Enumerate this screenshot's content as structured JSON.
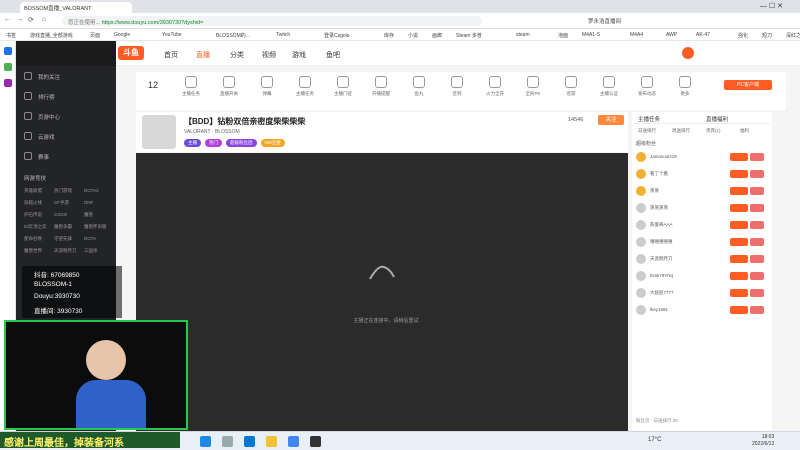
{
  "browser": {
    "tab_title": "BOSSOM直播_VALORANT",
    "url_prefix": "您正在使用...",
    "url": "https://www.douyu.com/3930730?dyshid=",
    "bookmarks": [
      "书签",
      "游戏直播_全部游戏",
      "页面",
      "Google",
      "YouTube",
      "BLOSSOM的...",
      "Twitch",
      "登录Csgola",
      "库存",
      "小说",
      "画廊",
      "Steam 多普",
      "steam",
      "泡面",
      "M4A1-S",
      "M4A4",
      "AWP",
      "AK-47",
      "强化",
      "短刀",
      "深红之"
    ],
    "addressbar_right_label": "罗永浩直播间"
  },
  "site": {
    "logo": "斗鱼",
    "nav": [
      "首页",
      "直播",
      "分类",
      "视频",
      "游戏",
      "鱼吧"
    ]
  },
  "sidebar": {
    "items": [
      "我的关注",
      "排行榜",
      "页游中心",
      "云游戏",
      "赛事"
    ],
    "section_title": "网游竞技",
    "games": [
      [
        "英雄联盟",
        "热门游戏",
        "DOTA2"
      ],
      [
        "穿越火线",
        "CF手游",
        "DNF"
      ],
      [
        "炉石传说",
        "CSGO",
        "魔兽"
      ],
      [
        "lol云顶之弈",
        "魔兽争霸",
        "魔兽怀旧服"
      ],
      [
        "使命召唤",
        "守望先锋",
        "DOTA"
      ],
      [
        "魔兽世界",
        "天涯明月刀",
        "三国杀"
      ]
    ]
  },
  "toolbar": {
    "count": "12",
    "items": [
      "主播任务",
      "直播开关",
      "弹幕",
      "主播任务",
      "主播门徒",
      "开播提醒",
      "鱼丸",
      "签到",
      "火力全开",
      "全民PK",
      "巡游",
      "主播认证",
      "发布动态",
      "更多"
    ],
    "pc_button": "PC客户端"
  },
  "room": {
    "badge": "【BDD】",
    "title": "钻粉双倍亲密度柴柴柴柴",
    "category_tag": "VALORANT",
    "owner": "BLOSSOM",
    "online": "14546",
    "follow_label": "关注",
    "tags": [
      "主播",
      "热门",
      "超级粉丝团",
      "NW连胜"
    ]
  },
  "player": {
    "status_text": "主播正在连接中，请稍后重试"
  },
  "chat": {
    "tabs": [
      "主播任务",
      "直播福利"
    ],
    "sub_tabs": [
      "日送排行",
      "周送排行",
      "贵宾(1)",
      "福利"
    ],
    "hot_label": "超级粉丝",
    "rows": [
      "Jamosoul219",
      "看了个看",
      "蒸蒸",
      "蒸蒸蒸蒸",
      "陈俊奇AAA",
      "嘻嘻嘻嘻嘻",
      "天涯明月刀",
      "Erek79YNq",
      "大屁屁7777",
      "lkey1991"
    ],
    "footer": "粉丝页 · 日送排行 35"
  },
  "stream_overlay": {
    "lines": [
      "抖音: 67069850",
      "BLOSSOM-1",
      "Douyu:3930730",
      "直播间: 3930730"
    ],
    "bottom_text": "感谢上周最佳，掉装备河系"
  },
  "taskbar": {
    "temperature": "17°C",
    "time": "18:03",
    "date": "2022/6/13"
  }
}
